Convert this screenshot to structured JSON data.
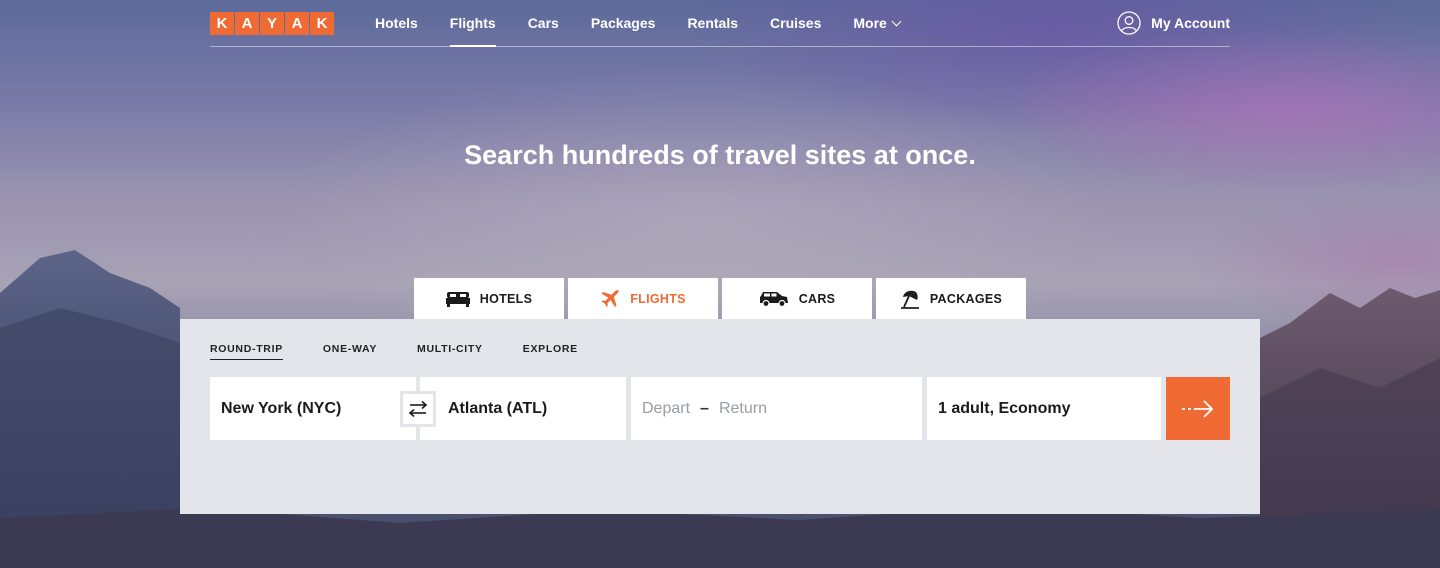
{
  "brand": {
    "letters": [
      "K",
      "A",
      "Y",
      "A",
      "K"
    ],
    "accent_color": "#ef6b33"
  },
  "nav": {
    "items": [
      {
        "label": "Hotels"
      },
      {
        "label": "Flights",
        "active": true
      },
      {
        "label": "Cars"
      },
      {
        "label": "Packages"
      },
      {
        "label": "Rentals"
      },
      {
        "label": "Cruises"
      },
      {
        "label": "More"
      }
    ],
    "account_label": "My Account"
  },
  "hero": {
    "headline": "Search hundreds of travel sites at once."
  },
  "search_tabs": [
    {
      "label": "HOTELS",
      "icon": "bed-icon"
    },
    {
      "label": "FLIGHTS",
      "icon": "plane-icon",
      "active": true
    },
    {
      "label": "CARS",
      "icon": "car-icon"
    },
    {
      "label": "PACKAGES",
      "icon": "beach-umbrella-icon"
    }
  ],
  "trip_types": [
    {
      "label": "ROUND-TRIP",
      "active": true
    },
    {
      "label": "ONE-WAY"
    },
    {
      "label": "MULTI-CITY"
    },
    {
      "label": "EXPLORE"
    }
  ],
  "form": {
    "origin": "New York (NYC)",
    "destination": "Atlanta (ATL)",
    "depart_placeholder": "Depart",
    "date_separator": "–",
    "return_placeholder": "Return",
    "travelers": "1 adult, Economy"
  }
}
